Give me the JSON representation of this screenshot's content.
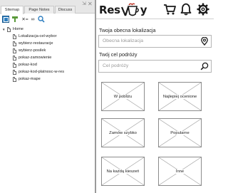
{
  "sitemap_panel": {
    "tabs": [
      {
        "label": "Sitemap"
      },
      {
        "label": "Page Notes"
      },
      {
        "label": "Discuss"
      }
    ],
    "tree": {
      "root": "Home",
      "children": [
        "Lokalizacja-cel-wybor",
        "wybierz-restauracje",
        "wybierz-posilek",
        "pokaz-zamowienie",
        "pokaz-kod",
        "pokaz-kod-platnosc-w-res",
        "pokaz-mape"
      ]
    }
  },
  "mockup": {
    "logo": {
      "left": "Res",
      "right": "y"
    },
    "location": {
      "label": "Twoja obecna lokalizacja",
      "placeholder": "Obecna lokalizacja"
    },
    "destination": {
      "label": "Twój cel podróży",
      "placeholder": "Cel podróży"
    },
    "tiles": [
      "W pobliżu",
      "Najlepiej ocenione",
      "Zamów szybko",
      "Popularne",
      "Na każdą kieszeń",
      "Inne"
    ]
  }
}
